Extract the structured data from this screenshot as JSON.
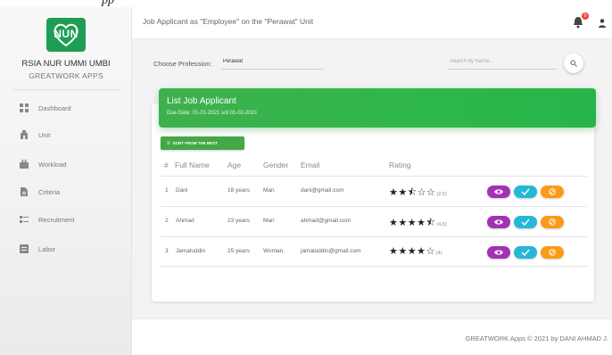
{
  "caption_fragment": "pp",
  "brand": {
    "logo_text": "NUN",
    "name": "RSIA NUR UMMI UMBI",
    "subtitle": "GREATWORK APPS",
    "logo_color": "#1e9e55"
  },
  "sidebar": {
    "items": [
      {
        "label": "Dashboard",
        "icon": "dashboard-icon"
      },
      {
        "label": "Unit",
        "icon": "unit-icon"
      },
      {
        "label": "Workload",
        "icon": "workload-icon"
      },
      {
        "label": "Criteria",
        "icon": "criteria-icon"
      },
      {
        "label": "Recruitment",
        "icon": "recruitment-icon"
      },
      {
        "label": "Labor",
        "icon": "labor-icon"
      }
    ]
  },
  "header": {
    "title": "Job Applicant as \"Employee\" on the \"Perawat\" Unit",
    "notification_count": "0",
    "notification_icon": "bell-icon",
    "user_icon": "user-icon"
  },
  "filters": {
    "profession_label": "Choose Profession:",
    "profession_value": "Perawat",
    "search_placeholder": "Search by Name...",
    "search_icon": "search-icon"
  },
  "card": {
    "title": "List Job Applicant",
    "subtitle": "Due Date: 01-01-2021 s/d 01-02-2021",
    "accent_color": "#2fb84a",
    "sort_label": "SORT FROM THE BEST",
    "sort_icon": "sort-icon"
  },
  "table": {
    "columns": [
      "#",
      "Full Name",
      "Age",
      "Gender",
      "Email",
      "Rating"
    ],
    "rows": [
      {
        "no": "1",
        "name": "Dani",
        "age": "18 years",
        "gender": "Man",
        "email": "dani@gmail.com",
        "stars": "★★⯪☆☆",
        "score": "(2.5)",
        "rating": 2.5
      },
      {
        "no": "2",
        "name": "Ahmad",
        "age": "23 years",
        "gender": "Man",
        "email": "ahmad@gmail.com",
        "stars": "★★★★⯪",
        "score": "(4.5)",
        "rating": 4.5
      },
      {
        "no": "3",
        "name": "Jamaluddin",
        "age": "25 years",
        "gender": "Woman",
        "email": "jamaluddin@gmail.com",
        "stars": "★★★★☆",
        "score": "(4)",
        "rating": 4
      }
    ],
    "actions": [
      {
        "name": "view",
        "icon": "eye-icon",
        "color": "#a431b5"
      },
      {
        "name": "accept",
        "icon": "check-icon",
        "color": "#26b7d6"
      },
      {
        "name": "reject",
        "icon": "block-icon",
        "color": "#fb9a16"
      }
    ]
  },
  "footer": {
    "text": "GREATWORK Apps © 2021 by DANI AHMAD J."
  }
}
